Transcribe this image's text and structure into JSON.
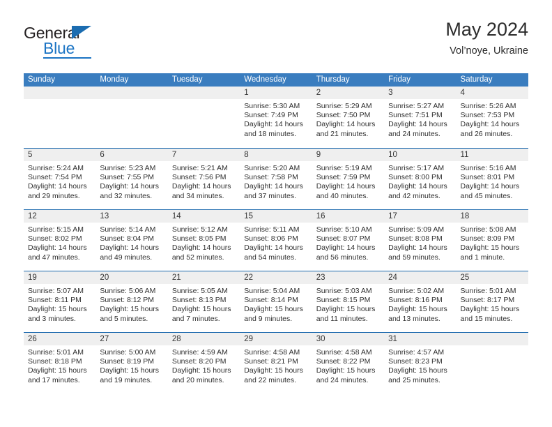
{
  "brand": {
    "name_dark": "General",
    "name_blue": "Blue",
    "accent_color": "#1b74c4",
    "triangle_color": "#1b6cb0"
  },
  "header": {
    "title": "May 2024",
    "subtitle": "Vol’noye, Ukraine"
  },
  "colors": {
    "header_row_bg": "#3a7dbf",
    "week_divider": "#1e6aae",
    "daynum_bg": "#efefef",
    "text": "#2f2f2f"
  },
  "weekdays": [
    "Sunday",
    "Monday",
    "Tuesday",
    "Wednesday",
    "Thursday",
    "Friday",
    "Saturday"
  ],
  "weeks": [
    [
      {
        "day": "",
        "sunrise": "",
        "sunset": "",
        "daylight1": "",
        "daylight2": ""
      },
      {
        "day": "",
        "sunrise": "",
        "sunset": "",
        "daylight1": "",
        "daylight2": ""
      },
      {
        "day": "",
        "sunrise": "",
        "sunset": "",
        "daylight1": "",
        "daylight2": ""
      },
      {
        "day": "1",
        "sunrise": "Sunrise: 5:30 AM",
        "sunset": "Sunset: 7:49 PM",
        "daylight1": "Daylight: 14 hours",
        "daylight2": "and 18 minutes."
      },
      {
        "day": "2",
        "sunrise": "Sunrise: 5:29 AM",
        "sunset": "Sunset: 7:50 PM",
        "daylight1": "Daylight: 14 hours",
        "daylight2": "and 21 minutes."
      },
      {
        "day": "3",
        "sunrise": "Sunrise: 5:27 AM",
        "sunset": "Sunset: 7:51 PM",
        "daylight1": "Daylight: 14 hours",
        "daylight2": "and 24 minutes."
      },
      {
        "day": "4",
        "sunrise": "Sunrise: 5:26 AM",
        "sunset": "Sunset: 7:53 PM",
        "daylight1": "Daylight: 14 hours",
        "daylight2": "and 26 minutes."
      }
    ],
    [
      {
        "day": "5",
        "sunrise": "Sunrise: 5:24 AM",
        "sunset": "Sunset: 7:54 PM",
        "daylight1": "Daylight: 14 hours",
        "daylight2": "and 29 minutes."
      },
      {
        "day": "6",
        "sunrise": "Sunrise: 5:23 AM",
        "sunset": "Sunset: 7:55 PM",
        "daylight1": "Daylight: 14 hours",
        "daylight2": "and 32 minutes."
      },
      {
        "day": "7",
        "sunrise": "Sunrise: 5:21 AM",
        "sunset": "Sunset: 7:56 PM",
        "daylight1": "Daylight: 14 hours",
        "daylight2": "and 34 minutes."
      },
      {
        "day": "8",
        "sunrise": "Sunrise: 5:20 AM",
        "sunset": "Sunset: 7:58 PM",
        "daylight1": "Daylight: 14 hours",
        "daylight2": "and 37 minutes."
      },
      {
        "day": "9",
        "sunrise": "Sunrise: 5:19 AM",
        "sunset": "Sunset: 7:59 PM",
        "daylight1": "Daylight: 14 hours",
        "daylight2": "and 40 minutes."
      },
      {
        "day": "10",
        "sunrise": "Sunrise: 5:17 AM",
        "sunset": "Sunset: 8:00 PM",
        "daylight1": "Daylight: 14 hours",
        "daylight2": "and 42 minutes."
      },
      {
        "day": "11",
        "sunrise": "Sunrise: 5:16 AM",
        "sunset": "Sunset: 8:01 PM",
        "daylight1": "Daylight: 14 hours",
        "daylight2": "and 45 minutes."
      }
    ],
    [
      {
        "day": "12",
        "sunrise": "Sunrise: 5:15 AM",
        "sunset": "Sunset: 8:02 PM",
        "daylight1": "Daylight: 14 hours",
        "daylight2": "and 47 minutes."
      },
      {
        "day": "13",
        "sunrise": "Sunrise: 5:14 AM",
        "sunset": "Sunset: 8:04 PM",
        "daylight1": "Daylight: 14 hours",
        "daylight2": "and 49 minutes."
      },
      {
        "day": "14",
        "sunrise": "Sunrise: 5:12 AM",
        "sunset": "Sunset: 8:05 PM",
        "daylight1": "Daylight: 14 hours",
        "daylight2": "and 52 minutes."
      },
      {
        "day": "15",
        "sunrise": "Sunrise: 5:11 AM",
        "sunset": "Sunset: 8:06 PM",
        "daylight1": "Daylight: 14 hours",
        "daylight2": "and 54 minutes."
      },
      {
        "day": "16",
        "sunrise": "Sunrise: 5:10 AM",
        "sunset": "Sunset: 8:07 PM",
        "daylight1": "Daylight: 14 hours",
        "daylight2": "and 56 minutes."
      },
      {
        "day": "17",
        "sunrise": "Sunrise: 5:09 AM",
        "sunset": "Sunset: 8:08 PM",
        "daylight1": "Daylight: 14 hours",
        "daylight2": "and 59 minutes."
      },
      {
        "day": "18",
        "sunrise": "Sunrise: 5:08 AM",
        "sunset": "Sunset: 8:09 PM",
        "daylight1": "Daylight: 15 hours",
        "daylight2": "and 1 minute."
      }
    ],
    [
      {
        "day": "19",
        "sunrise": "Sunrise: 5:07 AM",
        "sunset": "Sunset: 8:11 PM",
        "daylight1": "Daylight: 15 hours",
        "daylight2": "and 3 minutes."
      },
      {
        "day": "20",
        "sunrise": "Sunrise: 5:06 AM",
        "sunset": "Sunset: 8:12 PM",
        "daylight1": "Daylight: 15 hours",
        "daylight2": "and 5 minutes."
      },
      {
        "day": "21",
        "sunrise": "Sunrise: 5:05 AM",
        "sunset": "Sunset: 8:13 PM",
        "daylight1": "Daylight: 15 hours",
        "daylight2": "and 7 minutes."
      },
      {
        "day": "22",
        "sunrise": "Sunrise: 5:04 AM",
        "sunset": "Sunset: 8:14 PM",
        "daylight1": "Daylight: 15 hours",
        "daylight2": "and 9 minutes."
      },
      {
        "day": "23",
        "sunrise": "Sunrise: 5:03 AM",
        "sunset": "Sunset: 8:15 PM",
        "daylight1": "Daylight: 15 hours",
        "daylight2": "and 11 minutes."
      },
      {
        "day": "24",
        "sunrise": "Sunrise: 5:02 AM",
        "sunset": "Sunset: 8:16 PM",
        "daylight1": "Daylight: 15 hours",
        "daylight2": "and 13 minutes."
      },
      {
        "day": "25",
        "sunrise": "Sunrise: 5:01 AM",
        "sunset": "Sunset: 8:17 PM",
        "daylight1": "Daylight: 15 hours",
        "daylight2": "and 15 minutes."
      }
    ],
    [
      {
        "day": "26",
        "sunrise": "Sunrise: 5:01 AM",
        "sunset": "Sunset: 8:18 PM",
        "daylight1": "Daylight: 15 hours",
        "daylight2": "and 17 minutes."
      },
      {
        "day": "27",
        "sunrise": "Sunrise: 5:00 AM",
        "sunset": "Sunset: 8:19 PM",
        "daylight1": "Daylight: 15 hours",
        "daylight2": "and 19 minutes."
      },
      {
        "day": "28",
        "sunrise": "Sunrise: 4:59 AM",
        "sunset": "Sunset: 8:20 PM",
        "daylight1": "Daylight: 15 hours",
        "daylight2": "and 20 minutes."
      },
      {
        "day": "29",
        "sunrise": "Sunrise: 4:58 AM",
        "sunset": "Sunset: 8:21 PM",
        "daylight1": "Daylight: 15 hours",
        "daylight2": "and 22 minutes."
      },
      {
        "day": "30",
        "sunrise": "Sunrise: 4:58 AM",
        "sunset": "Sunset: 8:22 PM",
        "daylight1": "Daylight: 15 hours",
        "daylight2": "and 24 minutes."
      },
      {
        "day": "31",
        "sunrise": "Sunrise: 4:57 AM",
        "sunset": "Sunset: 8:23 PM",
        "daylight1": "Daylight: 15 hours",
        "daylight2": "and 25 minutes."
      },
      {
        "day": "",
        "sunrise": "",
        "sunset": "",
        "daylight1": "",
        "daylight2": ""
      }
    ]
  ]
}
